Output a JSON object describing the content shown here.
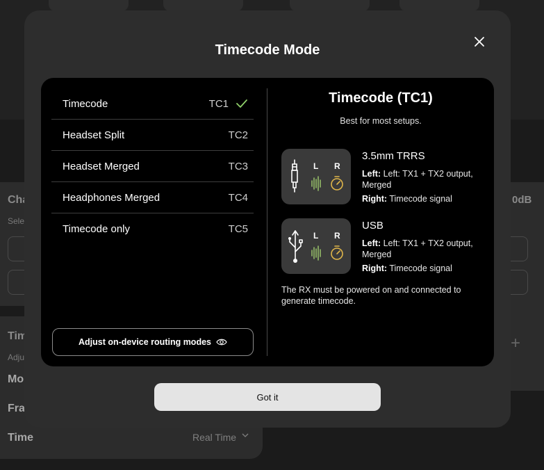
{
  "background": {
    "card1_label": "Cha",
    "card1_sub": "Sele",
    "card1_right_value": "0dB",
    "card2_label": "Tim",
    "card2_sub": "Adju",
    "row_mode_label": "Mo",
    "row_frame_label": "Fra",
    "row_time_label": "Time",
    "row_time_value": "Real Time"
  },
  "modal": {
    "title": "Timecode Mode",
    "modes": [
      {
        "label": "Timecode",
        "code": "TC1",
        "selected": true
      },
      {
        "label": "Headset Split",
        "code": "TC2",
        "selected": false
      },
      {
        "label": "Headset Merged",
        "code": "TC3",
        "selected": false
      },
      {
        "label": "Headphones Merged",
        "code": "TC4",
        "selected": false
      },
      {
        "label": "Timecode only",
        "code": "TC5",
        "selected": false
      }
    ],
    "routing_button_label": "Adjust on-device routing modes",
    "detail": {
      "title": "Timecode (TC1)",
      "subtitle": "Best for most setups.",
      "outputs": [
        {
          "name": "3.5mm TRRS",
          "icon": "trrs-jack-icon",
          "left_key": "Left:",
          "left_value": "Left: TX1 + TX2 output, Merged",
          "right_key": "Right:",
          "right_value": "Timecode signal",
          "channel_l": "L",
          "channel_r": "R"
        },
        {
          "name": "USB",
          "icon": "usb-icon",
          "left_key": "Left:",
          "left_value": "Left: TX1 + TX2 output, Merged",
          "right_key": "Right:",
          "right_value": "Timecode signal",
          "channel_l": "L",
          "channel_r": "R"
        }
      ],
      "note": "The RX must be powered on and connected to generate timecode."
    },
    "confirm_label": "Got it"
  },
  "colors": {
    "accent_green": "#8fd06a",
    "waveform_green": "#9ac46b",
    "timer_yellow": "#e0b64a"
  }
}
